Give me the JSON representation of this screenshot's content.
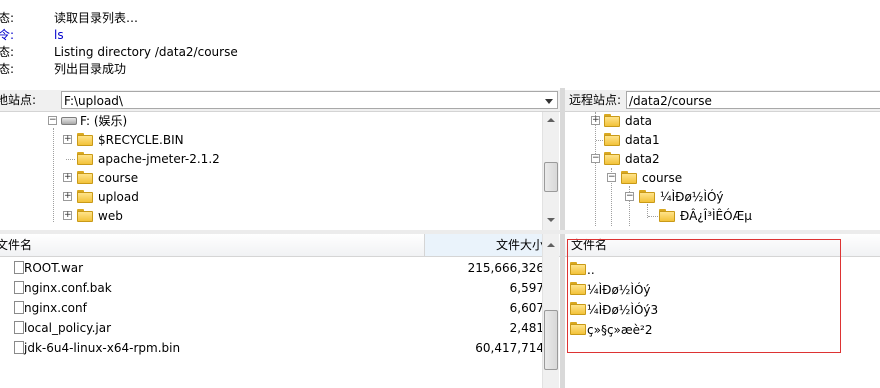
{
  "log": [
    {
      "label": "态:",
      "text": "读取目录列表…",
      "kind": "status"
    },
    {
      "label": "令:",
      "text": "ls",
      "kind": "command"
    },
    {
      "label": "态:",
      "text": "Listing directory /data2/course",
      "kind": "status"
    },
    {
      "label": "态:",
      "text": "列出目录成功",
      "kind": "status"
    }
  ],
  "local": {
    "site_label": "地站点:",
    "path": "F:\\upload\\",
    "tree": [
      {
        "label": "F: (娱乐)",
        "icon": "drive-icon"
      },
      {
        "label": "$RECYCLE.BIN",
        "icon": "folder-icon"
      },
      {
        "label": "apache-jmeter-2.1.2",
        "icon": "folder-icon"
      },
      {
        "label": "course",
        "icon": "folder-icon"
      },
      {
        "label": "upload",
        "icon": "folder-icon"
      },
      {
        "label": "web",
        "icon": "folder-icon"
      }
    ],
    "columns": {
      "name": "文件名",
      "size": "文件大小"
    },
    "files": [
      {
        "name": "ROOT.war",
        "size": "215,666,326"
      },
      {
        "name": "nginx.conf.bak",
        "size": "6,597"
      },
      {
        "name": "nginx.conf",
        "size": "6,607"
      },
      {
        "name": "local_policy.jar",
        "size": "2,481"
      },
      {
        "name": "jdk-6u4-linux-x64-rpm.bin",
        "size": "60,417,714"
      }
    ]
  },
  "remote": {
    "site_label": "远程站点:",
    "path": "/data2/course",
    "tree": [
      {
        "label": "data",
        "icon": "folder-icon"
      },
      {
        "label": "data1",
        "icon": "folder-icon"
      },
      {
        "label": "data2",
        "icon": "folder-icon"
      },
      {
        "label": "course",
        "icon": "folder-icon"
      },
      {
        "label": "¼ÌÐø½ÌÓý",
        "icon": "folder-icon"
      },
      {
        "label": "ÐÂ¿Î³ÌÊÓÆµ",
        "icon": "folder-icon"
      }
    ],
    "columns": {
      "name": "文件名"
    },
    "files": [
      {
        "name": ".."
      },
      {
        "name": "¼ÌÐø½ÌÓý"
      },
      {
        "name": "¼ÌÐø½ÌÓý3"
      },
      {
        "name": "ç»§ç»­æè²2"
      }
    ]
  },
  "colors": {
    "highlight_box": "#dd3333",
    "command_text": "#0000cc"
  }
}
